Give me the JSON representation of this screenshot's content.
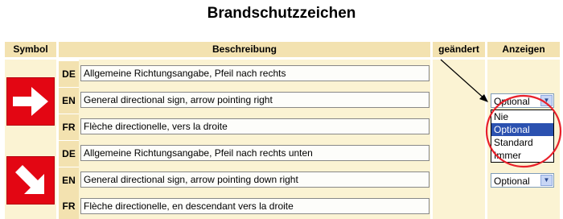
{
  "page_title": "Brandschutzzeichen",
  "headers": {
    "symbol": "Symbol",
    "beschreibung": "Beschreibung",
    "geaendert": "geändert",
    "anzeigen": "Anzeigen"
  },
  "rows": [
    {
      "symbol_icon": "arrow-right-icon",
      "entries": [
        {
          "lang": "DE",
          "text": "Allgemeine Richtungsangabe, Pfeil nach rechts"
        },
        {
          "lang": "EN",
          "text": "General directional sign, arrow pointing right"
        },
        {
          "lang": "FR",
          "text": "Flèche directionelle, vers la droite"
        }
      ],
      "anzeigen": "Optional"
    },
    {
      "symbol_icon": "arrow-down-right-icon",
      "entries": [
        {
          "lang": "DE",
          "text": "Allgemeine Richtungsangabe, Pfeil nach rechts unten"
        },
        {
          "lang": "EN",
          "text": "General directional sign, arrow pointing down right"
        },
        {
          "lang": "FR",
          "text": "Flèche directionelle, en descendant vers la droite"
        }
      ],
      "anzeigen": "Optional"
    }
  ],
  "dropdown_options": [
    "Nie",
    "Optional",
    "Standard",
    "Immer"
  ],
  "dropdown_highlighted": "Optional",
  "colors": {
    "header_bg": "#f3e2b0",
    "column_bg": "#fbf3d3",
    "sign_red": "#e30613",
    "highlight_blue": "#2b51b0",
    "annotation_red": "#e8202a"
  }
}
